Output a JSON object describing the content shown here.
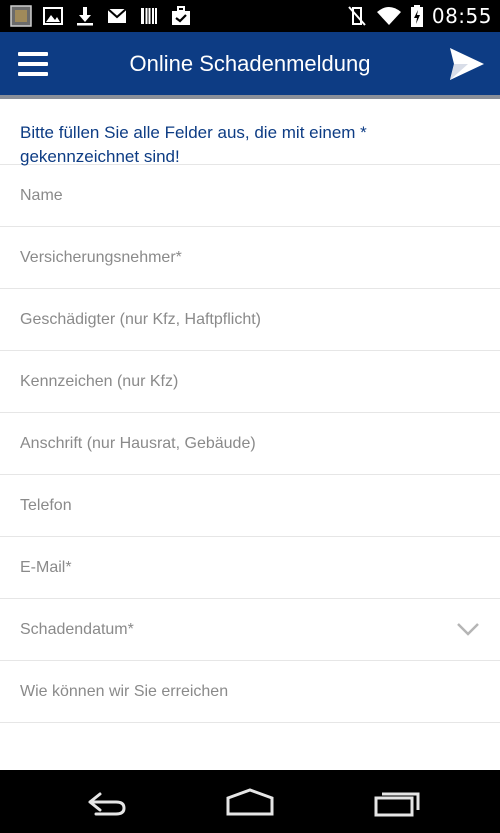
{
  "status_bar": {
    "time": "08:55",
    "left_icons": [
      "gallery-thumbnail-icon",
      "image-icon",
      "download-icon",
      "gmail-icon",
      "barcode-icon",
      "briefcase-check-icon"
    ],
    "right_icons": [
      "vibrate-off-icon",
      "wifi-icon",
      "battery-charging-icon"
    ]
  },
  "app_bar": {
    "title": "Online Schadenmeldung",
    "menu_icon": "hamburger-menu-icon",
    "send_icon": "send-icon",
    "color": "#0d3c84"
  },
  "form": {
    "intro": "Bitte füllen Sie alle Felder aus, die mit einem * gekennzeichnet sind!",
    "fields": [
      {
        "label": "Name"
      },
      {
        "label": "Versicherungsnehmer*"
      },
      {
        "label": "Geschädigter (nur Kfz, Haftpflicht)"
      },
      {
        "label": "Kennzeichen (nur Kfz)"
      },
      {
        "label": "Anschrift (nur Hausrat, Gebäude)"
      },
      {
        "label": "Telefon"
      },
      {
        "label": "E-Mail*"
      },
      {
        "label": "Schadendatum*",
        "dropdown": true
      },
      {
        "label": "Wie können wir Sie erreichen"
      }
    ]
  },
  "nav_bar": {
    "buttons": [
      "back-icon",
      "home-icon",
      "recent-apps-icon"
    ]
  }
}
